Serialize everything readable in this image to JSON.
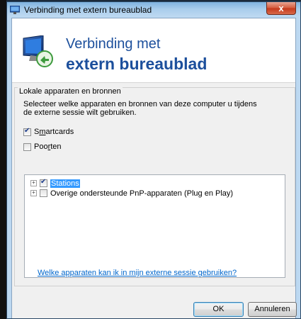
{
  "window": {
    "title": "Verbinding met extern bureaublad",
    "close_label": "x"
  },
  "banner": {
    "line1": "Verbinding met",
    "line2": "extern bureaublad"
  },
  "group": {
    "legend": "Lokale apparaten en bronnen",
    "description": "Selecteer welke apparaten en bronnen van deze computer u tijdens de externe sessie wilt gebruiken."
  },
  "options": {
    "smartcards": {
      "label_prefix": "S",
      "label_underlined": "m",
      "label_rest": "artcards",
      "checked": true
    },
    "poorten": {
      "label_prefix": "Poo",
      "label_underlined": "r",
      "label_rest": "ten",
      "checked": false
    }
  },
  "tree": {
    "items": [
      {
        "label": "Stations",
        "checked": true,
        "selected": true
      },
      {
        "label": "Overige ondersteunde PnP-apparaten (Plug en Play)",
        "checked": false,
        "selected": false
      }
    ]
  },
  "help_link": "Welke apparaten kan ik in mijn externe sessie gebruiken?",
  "buttons": {
    "ok": "OK",
    "cancel": "Annuleren"
  },
  "colors": {
    "accent": "#1c4f9c",
    "selection": "#3399ff",
    "link": "#0066cc"
  }
}
